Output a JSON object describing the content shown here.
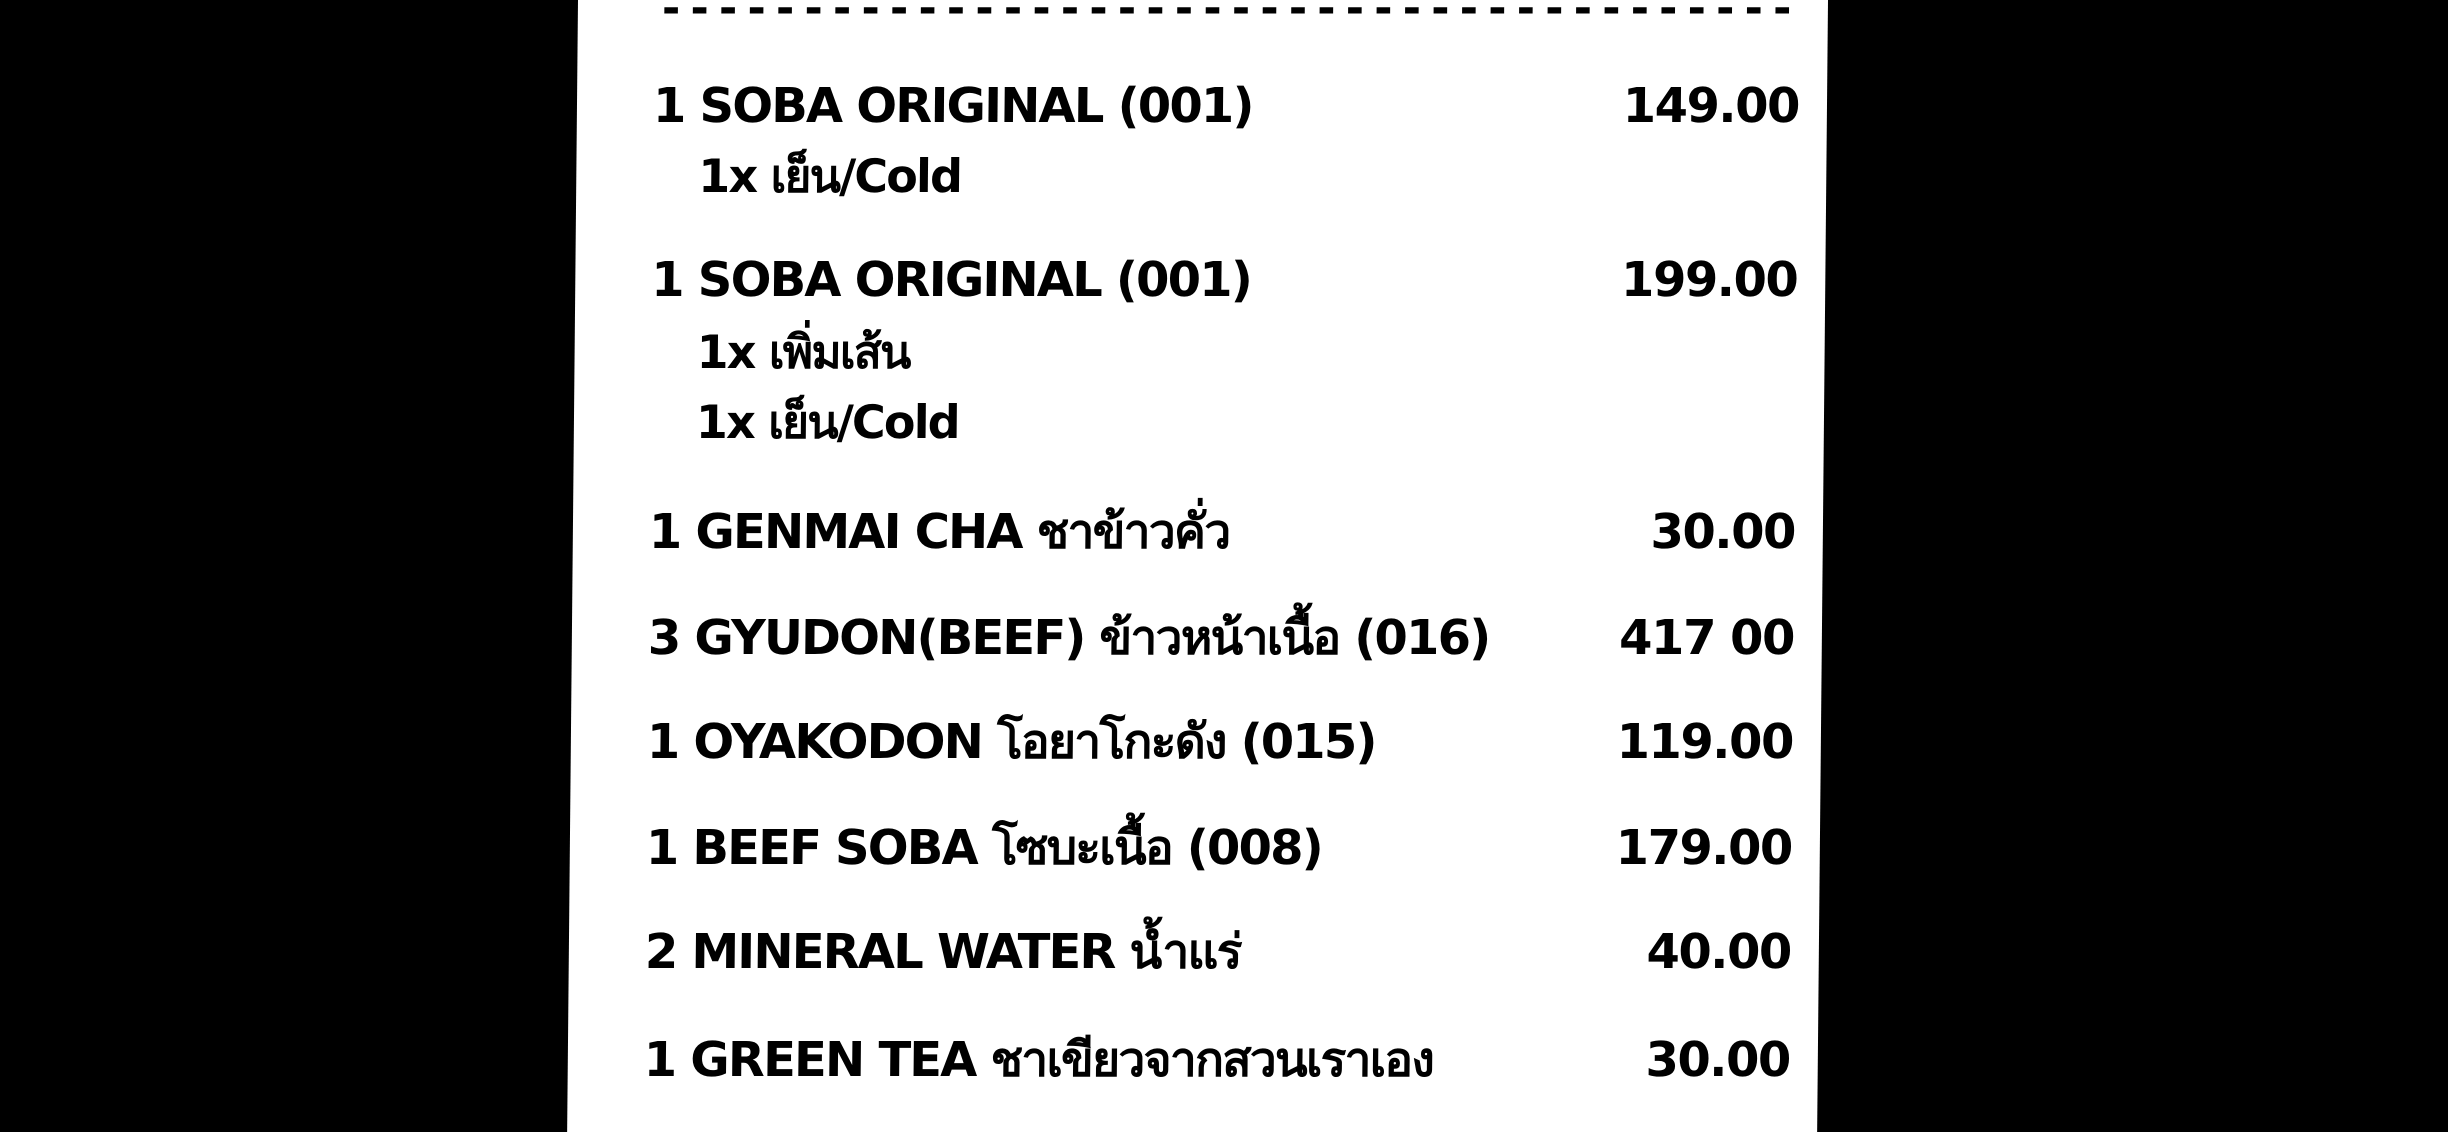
{
  "receipt": {
    "divider": "------------------------------------------",
    "items": [
      {
        "line": "1 SOBA ORIGINAL (001)",
        "price": "149.00",
        "modifiers": [
          "1x เย็น/Cold"
        ]
      },
      {
        "line": "1 SOBA ORIGINAL (001)",
        "price": "199.00",
        "modifiers": [
          "1x เพิ่มเส้น",
          "1x เย็น/Cold"
        ]
      },
      {
        "line": "1 GENMAI CHA ชาข้าวคั่ว",
        "price": "30.00",
        "modifiers": []
      },
      {
        "line": "3 GYUDON(BEEF) ข้าวหน้าเนื้อ (016)",
        "price": "417 00",
        "modifiers": []
      },
      {
        "line": "1 OYAKODON โอยาโกะดัง (015)",
        "price": "119.00",
        "modifiers": []
      },
      {
        "line": "1 BEEF SOBA โซบะเนื้อ (008)",
        "price": "179.00",
        "modifiers": []
      },
      {
        "line": "2 MINERAL WATER น้ำแร่",
        "price": "40.00",
        "modifiers": []
      },
      {
        "line": "1 GREEN TEA ชาเขียวจากสวนเราเอง",
        "price": "30.00",
        "modifiers": []
      }
    ]
  }
}
